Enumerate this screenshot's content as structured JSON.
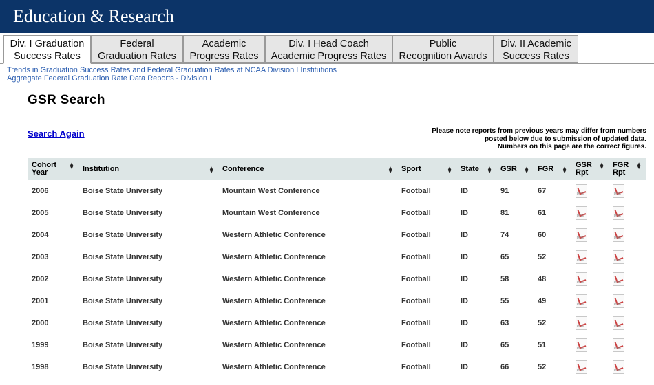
{
  "header": {
    "title": "Education & Research"
  },
  "tabs": [
    {
      "line1": "Div. I Graduation",
      "line2": "Success Rates",
      "active": true
    },
    {
      "line1": "Federal",
      "line2": "Graduation Rates",
      "active": false
    },
    {
      "line1": "Academic",
      "line2": "Progress Rates",
      "active": false
    },
    {
      "line1": "Div. I Head Coach",
      "line2": "Academic Progress Rates",
      "active": false
    },
    {
      "line1": "Public",
      "line2": "Recognition Awards",
      "active": false
    },
    {
      "line1": "Div. II Academic",
      "line2": "Success Rates",
      "active": false
    }
  ],
  "sublinks": [
    "Trends in Graduation Success Rates and Federal Graduation Rates at NCAA Division I Institutions",
    "Aggregate Federal Graduation Rate Data Reports - Division I"
  ],
  "page_title": "GSR Search",
  "search_again": "Search Again",
  "note": {
    "line1": "Please note reports from previous years may differ from numbers",
    "line2": "posted below due to submission of updated data.",
    "line3": "Numbers on this page are the correct figures."
  },
  "table": {
    "headers": [
      {
        "line1": "Cohort",
        "line2": "Year"
      },
      {
        "line1": "Institution",
        "line2": ""
      },
      {
        "line1": "Conference",
        "line2": ""
      },
      {
        "line1": "Sport",
        "line2": ""
      },
      {
        "line1": "State",
        "line2": ""
      },
      {
        "line1": "GSR",
        "line2": ""
      },
      {
        "line1": "FGR",
        "line2": ""
      },
      {
        "line1": "GSR",
        "line2": "Rpt"
      },
      {
        "line1": "FGR",
        "line2": "Rpt"
      }
    ],
    "rows": [
      {
        "year": "2006",
        "institution": "Boise State University",
        "conference": "Mountain West Conference",
        "sport": "Football",
        "state": "ID",
        "gsr": "91",
        "fgr": "67"
      },
      {
        "year": "2005",
        "institution": "Boise State University",
        "conference": "Mountain West Conference",
        "sport": "Football",
        "state": "ID",
        "gsr": "81",
        "fgr": "61"
      },
      {
        "year": "2004",
        "institution": "Boise State University",
        "conference": "Western Athletic Conference",
        "sport": "Football",
        "state": "ID",
        "gsr": "74",
        "fgr": "60"
      },
      {
        "year": "2003",
        "institution": "Boise State University",
        "conference": "Western Athletic Conference",
        "sport": "Football",
        "state": "ID",
        "gsr": "65",
        "fgr": "52"
      },
      {
        "year": "2002",
        "institution": "Boise State University",
        "conference": "Western Athletic Conference",
        "sport": "Football",
        "state": "ID",
        "gsr": "58",
        "fgr": "48"
      },
      {
        "year": "2001",
        "institution": "Boise State University",
        "conference": "Western Athletic Conference",
        "sport": "Football",
        "state": "ID",
        "gsr": "55",
        "fgr": "49"
      },
      {
        "year": "2000",
        "institution": "Boise State University",
        "conference": "Western Athletic Conference",
        "sport": "Football",
        "state": "ID",
        "gsr": "63",
        "fgr": "52"
      },
      {
        "year": "1999",
        "institution": "Boise State University",
        "conference": "Western Athletic Conference",
        "sport": "Football",
        "state": "ID",
        "gsr": "65",
        "fgr": "51"
      },
      {
        "year": "1998",
        "institution": "Boise State University",
        "conference": "Western Athletic Conference",
        "sport": "Football",
        "state": "ID",
        "gsr": "66",
        "fgr": "52"
      }
    ]
  },
  "icons": {
    "sort": "sort-arrows-icon",
    "report": "pdf-icon"
  },
  "colors": {
    "banner": "#0c3468",
    "link": "#2a5db0",
    "header_bg": "#dde6e6"
  }
}
